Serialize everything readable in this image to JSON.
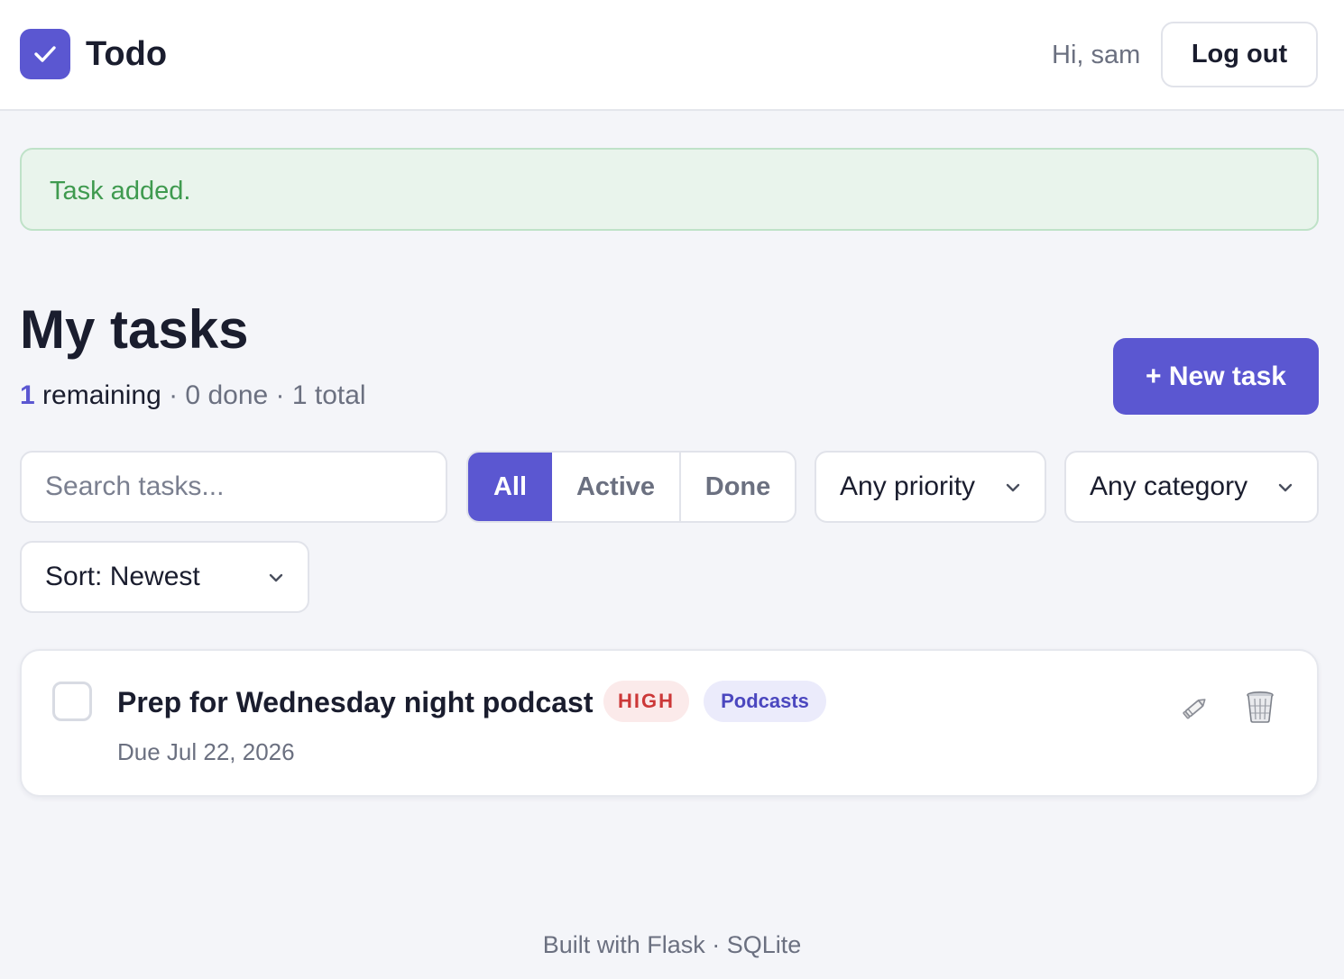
{
  "header": {
    "app_title": "Todo",
    "greeting": "Hi, sam",
    "logout_label": "Log out"
  },
  "flash": {
    "message": "Task added."
  },
  "main": {
    "title": "My tasks",
    "summary": {
      "remaining_count": "1",
      "remaining_label": "remaining",
      "rest": "· 0 done · 1 total"
    },
    "new_task_label": "+ New task"
  },
  "filters": {
    "search_placeholder": "Search tasks...",
    "status_tabs": [
      "All",
      "Active",
      "Done"
    ],
    "selected_status": "All",
    "priority_selected": "Any priority",
    "category_selected": "Any category",
    "sort_selected": "Sort: Newest"
  },
  "tasks": [
    {
      "title": "Prep for Wednesday night podcast",
      "priority": "HIGH",
      "category": "Podcasts",
      "due": "Due Jul 22, 2026",
      "completed": false
    }
  ],
  "icons": {
    "logo": "check-icon",
    "edit": "pencil-icon",
    "delete": "trash-icon",
    "dropdown": "chevron-down-icon"
  },
  "colors": {
    "accent": "#5b57d1",
    "success_bg": "#e9f4ec",
    "success_text": "#3f9a4f",
    "high_bg": "#fbeaea",
    "high_text": "#cc3838",
    "category_bg": "#ebebfb",
    "category_text": "#4b47bf"
  },
  "footer": {
    "text": "Built with Flask · SQLite"
  }
}
